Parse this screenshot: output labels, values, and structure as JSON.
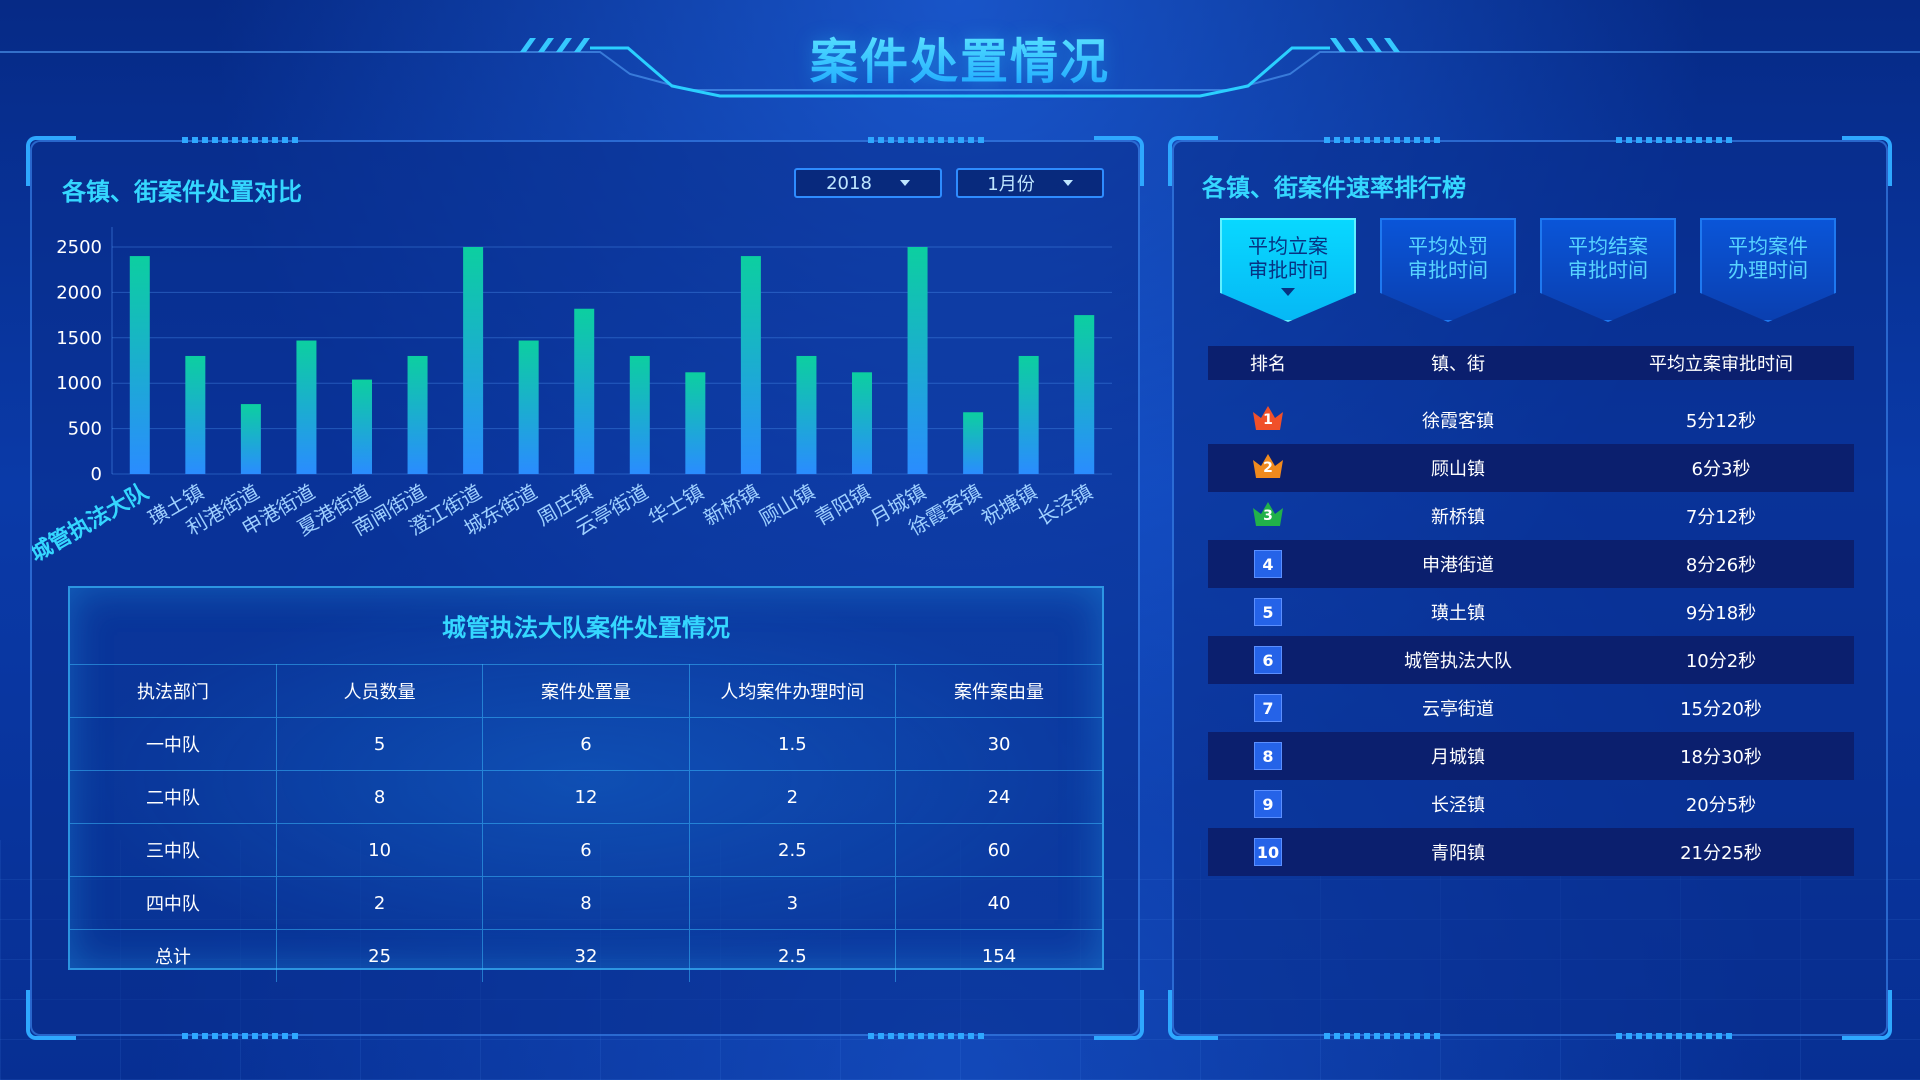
{
  "page": {
    "title": "案件处置情况"
  },
  "left_panel": {
    "title": "各镇、街案件处置对比",
    "filters": {
      "year": "2018",
      "month": "1月份"
    }
  },
  "chart_data": {
    "type": "bar",
    "categories": [
      "城管执法大队",
      "璜土镇",
      "利港街道",
      "申港街道",
      "夏港街道",
      "南闸街道",
      "澄江街道",
      "城东街道",
      "周庄镇",
      "云亭街道",
      "华士镇",
      "新桥镇",
      "顾山镇",
      "青阳镇",
      "月城镇",
      "徐霞客镇",
      "祝塘镇",
      "长泾镇"
    ],
    "values": [
      2400,
      1300,
      770,
      1470,
      1040,
      1300,
      2500,
      1470,
      1820,
      1300,
      1120,
      2400,
      1300,
      1120,
      2500,
      680,
      1300,
      1750
    ],
    "ylim": [
      0,
      2500
    ],
    "yticks": [
      0,
      500,
      1000,
      1500,
      2000,
      2500
    ],
    "highlighted_category": "城管执法大队",
    "colors": {
      "bar_top": "#0ccfa0",
      "bar_bottom": "#2a8cff",
      "highlight_label": "#35d7ff",
      "label": "#9fd0ff"
    }
  },
  "detail_table": {
    "title": "城管执法大队案件处置情况",
    "columns": [
      "执法部门",
      "人员数量",
      "案件处置量",
      "人均案件办理时间",
      "案件案由量"
    ],
    "rows": [
      [
        "一中队",
        "5",
        "6",
        "1.5",
        "30"
      ],
      [
        "二中队",
        "8",
        "12",
        "2",
        "24"
      ],
      [
        "三中队",
        "10",
        "6",
        "2.5",
        "60"
      ],
      [
        "四中队",
        "2",
        "8",
        "3",
        "40"
      ],
      [
        "总计",
        "25",
        "32",
        "2.5",
        "154"
      ]
    ]
  },
  "right_panel": {
    "title": "各镇、街案件速率排行榜",
    "tabs": [
      {
        "line1": "平均立案",
        "line2": "审批时间",
        "active": true
      },
      {
        "line1": "平均处罚",
        "line2": "审批时间",
        "active": false
      },
      {
        "line1": "平均结案",
        "line2": "审批时间",
        "active": false
      },
      {
        "line1": "平均案件",
        "line2": "办理时间",
        "active": false
      }
    ],
    "ranking": {
      "columns": [
        "排名",
        "镇、街",
        "平均立案审批时间"
      ],
      "rows": [
        {
          "rank": "1",
          "name": "徐霞客镇",
          "time": "5分12秒",
          "medal_color": "#f0502a"
        },
        {
          "rank": "2",
          "name": "顾山镇",
          "time": "6分3秒",
          "medal_color": "#f08a1e"
        },
        {
          "rank": "3",
          "name": "新桥镇",
          "time": "7分12秒",
          "medal_color": "#21b14a"
        },
        {
          "rank": "4",
          "name": "申港街道",
          "time": "8分26秒"
        },
        {
          "rank": "5",
          "name": "璜土镇",
          "time": "9分18秒"
        },
        {
          "rank": "6",
          "name": "城管执法大队",
          "time": "10分2秒"
        },
        {
          "rank": "7",
          "name": "云亭街道",
          "time": "15分20秒"
        },
        {
          "rank": "8",
          "name": "月城镇",
          "time": "18分30秒"
        },
        {
          "rank": "9",
          "name": "长泾镇",
          "time": "20分5秒"
        },
        {
          "rank": "10",
          "name": "青阳镇",
          "time": "21分25秒"
        }
      ]
    }
  }
}
